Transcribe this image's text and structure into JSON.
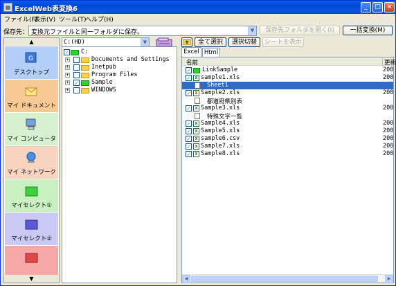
{
  "window": {
    "title": "ExcelWeb表変換6",
    "minimize": "_",
    "maximize": "□",
    "close": "×"
  },
  "menu": [
    "ファイル(F)",
    "表示(V)",
    "ツール(T)",
    "ヘルプ(H)"
  ],
  "savebar": {
    "label": "保存先：",
    "value": "変換元ファイルと同一フォルダに保存。",
    "open_folder": "保存先フォルダを開く(I)",
    "batch_convert": "一括変換(M)"
  },
  "left_panel": {
    "scroll_up": "▲",
    "scroll_down": "▼",
    "items": [
      {
        "label": "デスクトップ",
        "color": "#b3cef7"
      },
      {
        "label": "マイ ドキュメント",
        "color": "#f7c995"
      },
      {
        "label": "マイ コンピュータ",
        "color": "#d7f0d0"
      },
      {
        "label": "マイ ネットワーク",
        "color": "#f7d3c0"
      },
      {
        "label": "マイセレクト①",
        "color": "#c8f0c0"
      },
      {
        "label": "マイセレクト②",
        "color": "#c9c9f4"
      },
      {
        "label": "",
        "color": "#f6a8a8"
      }
    ]
  },
  "drive": {
    "value": "C:(HD)"
  },
  "tree": {
    "root": "C:",
    "items": [
      {
        "label": "Documents and Settings",
        "checked": false,
        "color": "yellow"
      },
      {
        "label": "Inetpub",
        "checked": false,
        "color": "yellow"
      },
      {
        "label": "Program Files",
        "checked": false,
        "color": "yellow"
      },
      {
        "label": "Sample",
        "checked": true,
        "color": "green"
      },
      {
        "label": "WINDOWS",
        "checked": false,
        "color": "yellow"
      }
    ]
  },
  "toolbar": {
    "select_all": "全て選択",
    "toggle_select": "選択切替",
    "show_sheet": "シートを表示"
  },
  "tabs": [
    "Excel",
    "Html"
  ],
  "list": {
    "header_name": "名前",
    "header_date": "更新",
    "rows": [
      {
        "name": "LinkSample",
        "type": "folder",
        "checked": true,
        "date": "200"
      },
      {
        "name": "sample1.xls",
        "type": "xls",
        "checked": true,
        "date": "200"
      },
      {
        "name": "Sheet1",
        "type": "sheet",
        "checked": false,
        "date": "",
        "selected": true
      },
      {
        "name": "Sample2.xls",
        "type": "xls",
        "checked": true,
        "date": "200"
      },
      {
        "name": "都道府県別表",
        "type": "sheet",
        "checked": false,
        "date": ""
      },
      {
        "name": "Sample3.xls",
        "type": "xls",
        "checked": true,
        "date": "200"
      },
      {
        "name": "特殊文字一覧",
        "type": "sheet",
        "checked": false,
        "date": ""
      },
      {
        "name": "Sample4.xls",
        "type": "xls",
        "checked": true,
        "date": "200"
      },
      {
        "name": "Sample5.xls",
        "type": "xls",
        "checked": true,
        "date": "200"
      },
      {
        "name": "sample6.csv",
        "type": "xls",
        "checked": true,
        "date": "200"
      },
      {
        "name": "Sample7.xls",
        "type": "xls",
        "checked": true,
        "date": "200"
      },
      {
        "name": "Sample8.xls",
        "type": "xls",
        "checked": true,
        "date": "200"
      }
    ]
  }
}
